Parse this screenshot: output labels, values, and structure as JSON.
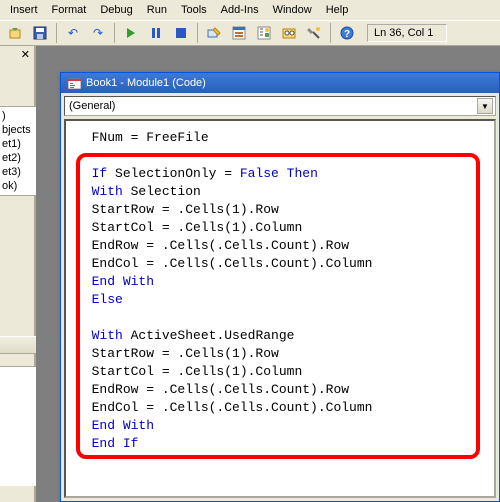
{
  "menu": {
    "insert": "Insert",
    "format": "Format",
    "debug": "Debug",
    "run": "Run",
    "tools": "Tools",
    "addins": "Add-Ins",
    "window": "Window",
    "help": "Help"
  },
  "status": {
    "cursor": "Ln 36, Col 1"
  },
  "project_tree": {
    "root_label": ")",
    "obj_label": "bjects",
    "items": [
      "et1)",
      "et2)",
      "et3)",
      "ok)"
    ]
  },
  "code_window": {
    "title": "Book1 - Module1 (Code)",
    "dropdown_left": "(General)"
  },
  "code": {
    "l01a": "FNum = FreeFile",
    "l02": "",
    "l03_if": "If",
    "l03_mid": " SelectionOnly = ",
    "l03_false": "False",
    "l03_then": " Then",
    "l04_with": "With",
    "l04_b": " Selection",
    "l05": "StartRow = .Cells(1).Row",
    "l06": "StartCol = .Cells(1).Column",
    "l07": "EndRow = .Cells(.Cells.Count).Row",
    "l08": "EndCol = .Cells(.Cells.Count).Column",
    "l09_endwith": "End With",
    "l10_else": "Else",
    "l11": "",
    "l12_with": "With",
    "l12_b": " ActiveSheet.UsedRange",
    "l13": "StartRow = .Cells(1).Row",
    "l14": "StartCol = .Cells(1).Column",
    "l15": "EndRow = .Cells(.Cells.Count).Row",
    "l16": "EndCol = .Cells(.Cells.Count).Column",
    "l17_endwith": "End With",
    "l18_endif": "End If"
  }
}
